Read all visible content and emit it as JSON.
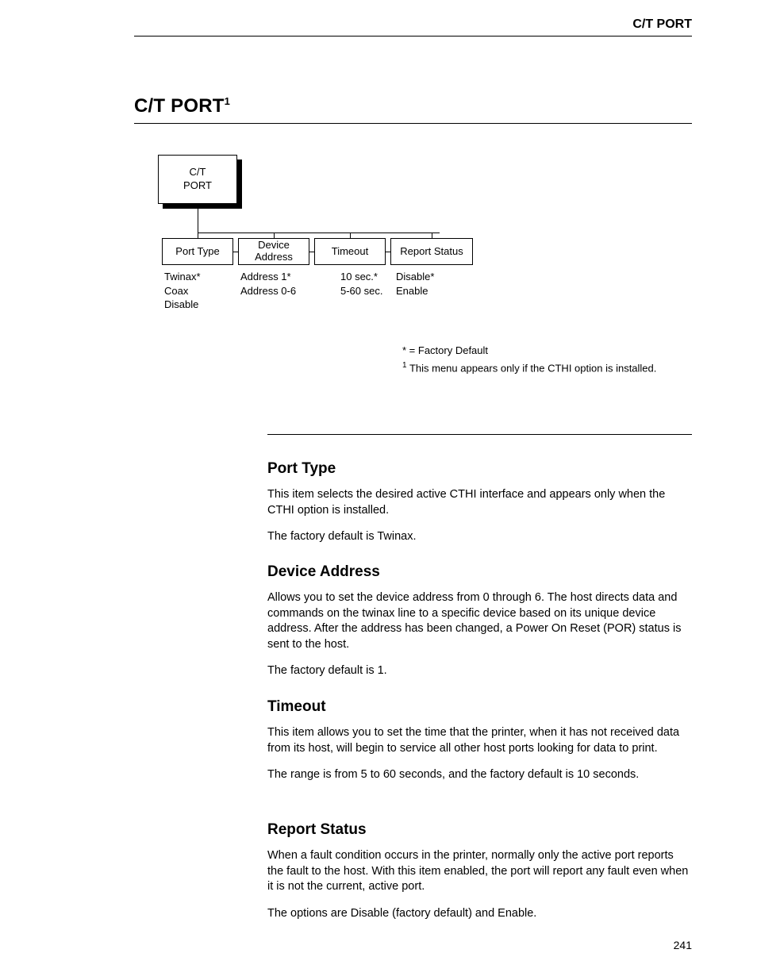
{
  "header_right": "C/T PORT",
  "section_title": "C/T PORT",
  "diagram": {
    "root_line1": "C/T",
    "root_line2": "PORT",
    "nodes": {
      "n1": "Port Type",
      "n2_line1": "Device",
      "n2_line2": "Address",
      "n3": "Timeout",
      "n4": "Report Status"
    },
    "options": {
      "o1": [
        "Twinax*",
        "Coax",
        "Disable"
      ],
      "o2": [
        "Address 1*",
        "Address 0-6"
      ],
      "o3": [
        "10 sec.*",
        "5-60 sec."
      ],
      "o4": [
        "Disable*",
        "Enable"
      ]
    }
  },
  "footnotes": {
    "default": "* = Factory Default",
    "note1": "This menu appears only if the CTHI option is installed."
  },
  "sections": {
    "port_type": {
      "title": "Port Type",
      "p1": "This item selects the desired active CTHI interface and appears only when the CTHI option is installed.",
      "p2": "The factory default is Twinax."
    },
    "device_address": {
      "title": "Device Address",
      "p1": "Allows you to set the device address from 0 through 6. The host directs data and commands on the twinax line to a specific device based on its unique device address. After the address has been changed, a Power On Reset (POR) status is sent to the host.",
      "p2": "The factory default is 1."
    },
    "timeout": {
      "title": "Timeout",
      "p1": "This item allows you to set the time that the printer, when it has not received data from its host, will begin to service all other host ports looking for data to print.",
      "p2": "The range is from 5 to 60 seconds, and the factory default is 10 seconds."
    },
    "report_status": {
      "title": "Report Status",
      "p1": "When a fault condition occurs in the printer, normally only the active port reports the fault to the host. With this item enabled, the port will report any fault even when it is not the current, active port.",
      "p2": "The options are Disable (factory default) and Enable."
    }
  },
  "page_number": "241"
}
